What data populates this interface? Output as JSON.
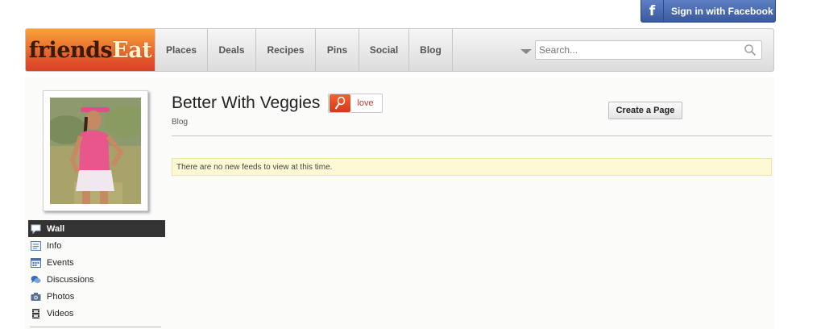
{
  "facebook": {
    "icon": "facebook-icon",
    "label": "Sign in with Facebook"
  },
  "header": {
    "logo": {
      "part1": "friends",
      "part2": "Eat"
    },
    "nav": [
      "Places",
      "Deals",
      "Recipes",
      "Pins",
      "Social",
      "Blog"
    ],
    "search": {
      "placeholder": "Search...",
      "value": ""
    }
  },
  "sidebar": {
    "items": [
      {
        "label": "Wall",
        "icon": "speech-bubble-icon",
        "active": true
      },
      {
        "label": "Info",
        "icon": "info-card-icon"
      },
      {
        "label": "Events",
        "icon": "calendar-icon"
      },
      {
        "label": "Discussions",
        "icon": "discussion-icon"
      },
      {
        "label": "Photos",
        "icon": "camera-icon"
      },
      {
        "label": "Videos",
        "icon": "film-icon"
      }
    ]
  },
  "main": {
    "title": "Better With Veggies",
    "love_label": "love",
    "subtitle": "Blog",
    "create_page_label": "Create a Page",
    "notice": "There are no new feeds to view at this time."
  },
  "colors": {
    "facebook_blue": "#3b5998",
    "logo_orange": "#e4572a",
    "notice_bg": "#fdf9d4",
    "love_red": "#c0392b"
  }
}
